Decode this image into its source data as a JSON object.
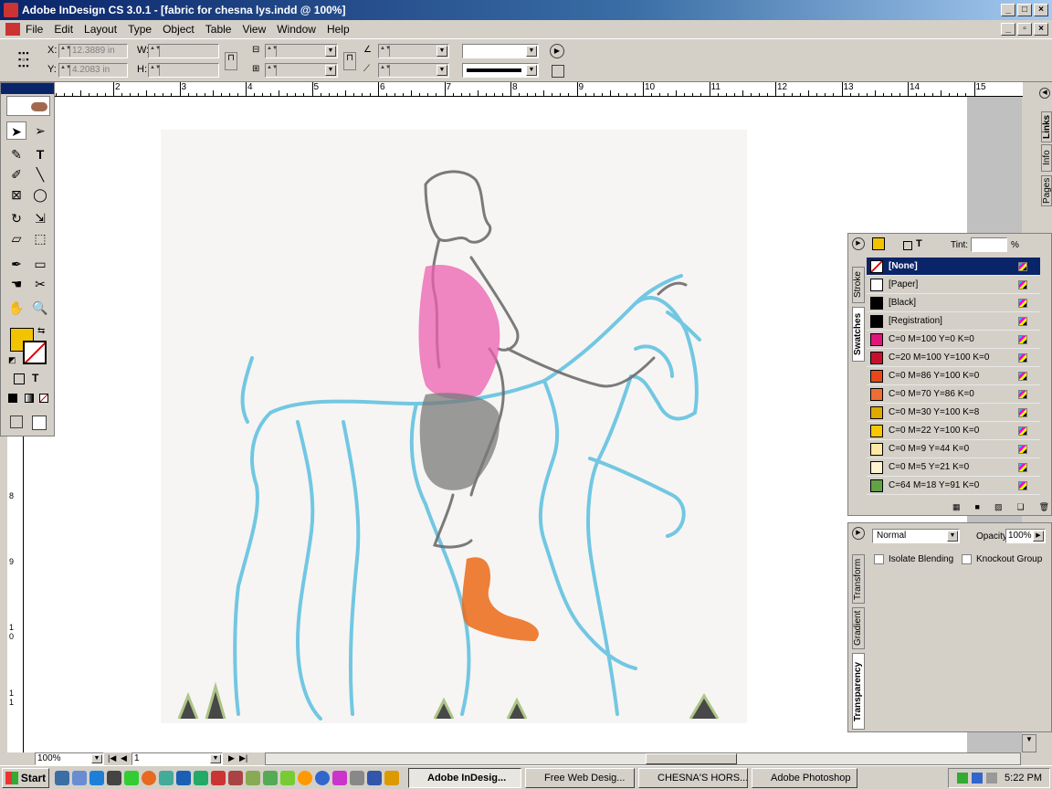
{
  "window": {
    "title": "Adobe InDesign CS 3.0.1 - [fabric for chesna lys.indd @ 100%]"
  },
  "menu": [
    "File",
    "Edit",
    "Layout",
    "Type",
    "Object",
    "Table",
    "View",
    "Window",
    "Help"
  ],
  "control": {
    "x_label": "X:",
    "x_value": "12.3889 in",
    "y_label": "Y:",
    "y_value": "4.2083 in",
    "w_label": "W:",
    "h_label": "H:"
  },
  "ruler": {
    "labels": [
      "2",
      "3",
      "4",
      "5",
      "6",
      "7",
      "8",
      "9",
      "10",
      "11",
      "12",
      "13",
      "14",
      "15"
    ]
  },
  "vruler": {
    "labels": [
      "8",
      "9",
      "1 0",
      "1 1"
    ]
  },
  "swatches": {
    "tabs": [
      "Stroke",
      "Swatches"
    ],
    "tint_label": "Tint:",
    "tint_unit": "%",
    "items": [
      {
        "name": "[None]",
        "color": "#ffffff",
        "selected": true
      },
      {
        "name": "[Paper]",
        "color": "#ffffff"
      },
      {
        "name": "[Black]",
        "color": "#000000"
      },
      {
        "name": "[Registration]",
        "color": "#000000"
      },
      {
        "name": "C=0 M=100 Y=0 K=0",
        "color": "#e0157c"
      },
      {
        "name": "C=20 M=100 Y=100 K=0",
        "color": "#c8102e"
      },
      {
        "name": "C=0 M=86 Y=100 K=0",
        "color": "#e8471c"
      },
      {
        "name": "C=0 M=70 Y=86 K=0",
        "color": "#ee6d34"
      },
      {
        "name": "C=0 M=30 Y=100 K=8",
        "color": "#e0a800"
      },
      {
        "name": "C=0 M=22 Y=100 K=0",
        "color": "#f7c700"
      },
      {
        "name": "C=0 M=9 Y=44 K=0",
        "color": "#fde9a4"
      },
      {
        "name": "C=0 M=5 Y=21 K=0",
        "color": "#fff2cf"
      },
      {
        "name": "C=64 M=18 Y=91 K=0",
        "color": "#62a244"
      }
    ]
  },
  "transparency": {
    "tabs": [
      "Transform",
      "Gradient",
      "Transparency"
    ],
    "mode": "Normal",
    "opacity_label": "Opacity:",
    "opacity": "100%",
    "isolate": "Isolate Blending",
    "knockout": "Knockout Group"
  },
  "side_tabs": [
    "Pages",
    "Info",
    "Links"
  ],
  "status": {
    "zoom": "100%",
    "page": "1"
  },
  "taskbar": {
    "start": "Start",
    "tasks": [
      {
        "label": "Adobe InDesig...",
        "active": true
      },
      {
        "label": "Free Web Desig..."
      },
      {
        "label": "CHESNA'S HORS..."
      },
      {
        "label": "Adobe Photoshop"
      }
    ],
    "clock": "5:22 PM"
  },
  "colors": {
    "fill": "#f2c300",
    "accent": "#0a246a"
  }
}
